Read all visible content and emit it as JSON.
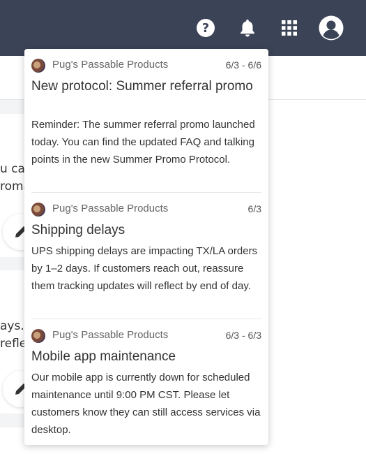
{
  "header": {
    "icons": [
      "help-icon",
      "bell-icon",
      "apps-grid-icon",
      "user-avatar-icon"
    ],
    "help_glyph": "?",
    "bar_color": "#3b4356"
  },
  "background": {
    "snippets": [
      "u car",
      "roma",
      "ays.",
      "refle"
    ]
  },
  "notifications": [
    {
      "org": "Pug's Passable Products",
      "date": "6/3 - 6/6",
      "title": "New protocol: Summer referral promo",
      "body": "Reminder: The summer referral promo launched today. You can find the updated FAQ and talking points in the new Summer Promo Protocol."
    },
    {
      "org": "Pug's Passable Products",
      "date": "6/3",
      "title": "Shipping delays",
      "body": "UPS shipping delays are impacting TX/LA orders by 1–2 days. If customers reach out, reassure them tracking updates will reflect by end of day."
    },
    {
      "org": "Pug's Passable Products",
      "date": "6/3 - 6/3",
      "title": "Mobile app maintenance",
      "body": "Our mobile app is currently down for scheduled maintenance until 9:00 PM CST. Please let customers know they can still access services via desktop."
    }
  ]
}
